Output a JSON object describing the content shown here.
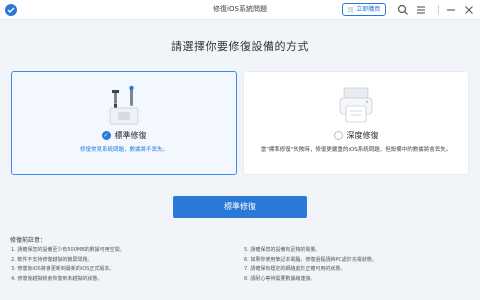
{
  "window": {
    "title": "修復iOS系統問題",
    "buy_label": "立即購買"
  },
  "icons": [
    "app-logo-icon",
    "cart-icon",
    "search-icon",
    "menu-icon",
    "minimize-icon",
    "close-icon"
  ],
  "heading": "請選擇你要修復設備的方式",
  "modes": {
    "standard": {
      "title": "標準修復",
      "description": "修復常見系統問題，數據將不丟失。",
      "selected": true
    },
    "deep": {
      "title": "深度修復",
      "description": "當\"標準修復\"失敗時，修復更嚴重的iOS系統問題，但設備中的數據將會丟失。",
      "selected": false
    }
  },
  "primary_button": "標準修復",
  "notes": {
    "title": "修復前註意：",
    "left": [
      "1. 請確保您的設備至少有500MB的數據可用空間。",
      "2. 軟件不支持修復越獄的鎖屏問題。",
      "3. 修復後iOS將會更新到最新的iOS正式版本。",
      "4. 修復後越獄將會恢復到未越獄的狀態。"
    ],
    "right": [
      "5. 請確保您的設備有足夠的電量。",
      "6. 如果你使用筆記本電腦，修復過程請將PC處於充電狀態。",
      "7. 請確保有穩定的網絡處於正確可用的狀態。",
      "8. 請耐心等待需要數據線連接。"
    ]
  },
  "colors": {
    "accent": "#2a78d8",
    "background": "#f1f4f9"
  }
}
